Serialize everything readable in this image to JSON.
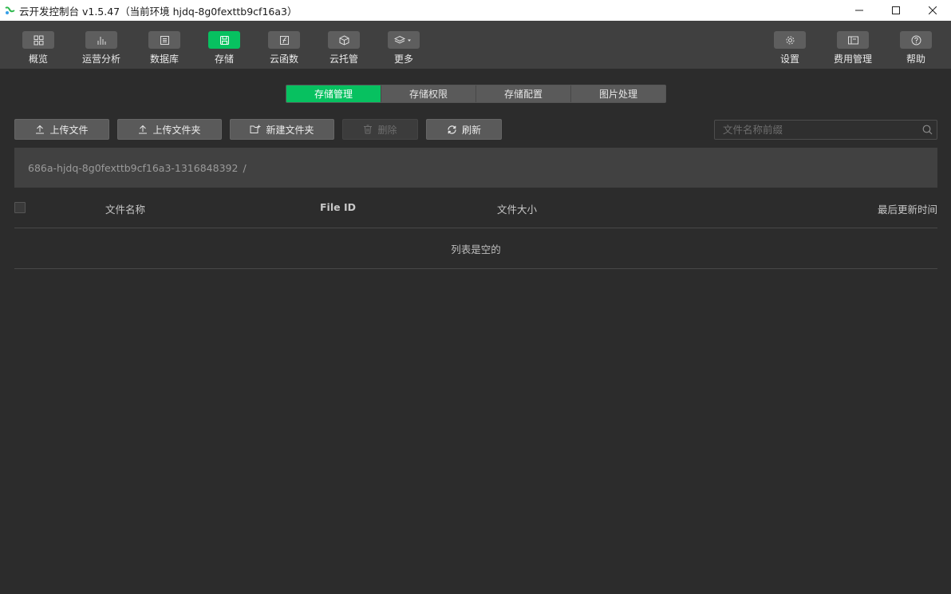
{
  "window": {
    "title": "云开发控制台 v1.5.47（当前环境 hjdq-8g0fexttb9cf16a3）"
  },
  "toolbar": {
    "items": [
      {
        "label": "概览",
        "icon": "grid-icon"
      },
      {
        "label": "运营分析",
        "icon": "bar-chart-icon"
      },
      {
        "label": "数据库",
        "icon": "database-icon"
      },
      {
        "label": "存储",
        "icon": "storage-icon",
        "active": true
      },
      {
        "label": "云函数",
        "icon": "function-icon"
      },
      {
        "label": "云托管",
        "icon": "cube-icon"
      },
      {
        "label": "更多",
        "icon": "layers-icon"
      }
    ],
    "right_items": [
      {
        "label": "设置",
        "icon": "gear-icon"
      },
      {
        "label": "费用管理",
        "icon": "billing-icon"
      },
      {
        "label": "帮助",
        "icon": "help-icon"
      }
    ]
  },
  "tabs": [
    {
      "label": "存储管理",
      "active": true
    },
    {
      "label": "存储权限"
    },
    {
      "label": "存储配置"
    },
    {
      "label": "图片处理"
    }
  ],
  "actions": {
    "upload_file": "上传文件",
    "upload_folder": "上传文件夹",
    "new_folder": "新建文件夹",
    "delete": "删除",
    "refresh": "刷新"
  },
  "search": {
    "placeholder": "文件名称前缀"
  },
  "path": {
    "bucket": "686a-hjdq-8g0fexttb9cf16a3-1316848392",
    "separator": "/"
  },
  "table": {
    "columns": {
      "name": "文件名称",
      "file_id": "File ID",
      "size": "文件大小",
      "updated": "最后更新时间"
    },
    "empty_text": "列表是空的"
  },
  "colors": {
    "accent": "#07c160",
    "background": "#2c2c2c",
    "toolbar": "#404040"
  }
}
